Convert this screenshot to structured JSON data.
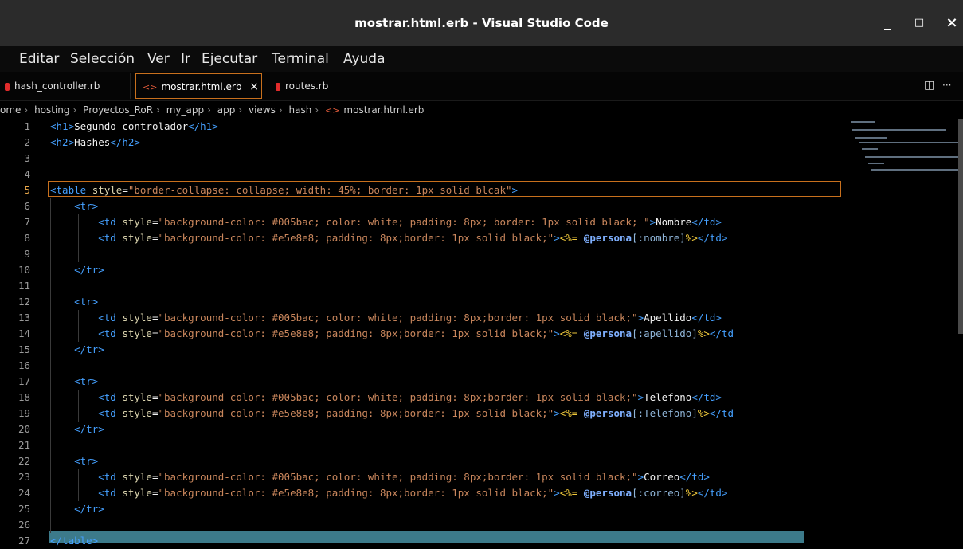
{
  "window": {
    "title": "mostrar.html.erb - Visual Studio Code",
    "minimize": "_",
    "maximize": "□",
    "close": "×"
  },
  "menu": [
    "Editar",
    "Selección",
    "Ver",
    "Ir",
    "Ejecutar",
    "Terminal",
    "Ayuda"
  ],
  "tabs": [
    {
      "label": "hash_controller.rb",
      "icon": "ruby-icon"
    },
    {
      "label": "mostrar.html.erb",
      "icon": "html-icon",
      "active": true,
      "close": "×"
    },
    {
      "label": "routes.rb",
      "icon": "ruby-icon"
    }
  ],
  "tab_actions": {
    "split": "◫",
    "more": "···"
  },
  "breadcrumb": [
    "home",
    "hosting",
    "Proyectos_RoR",
    "my_app",
    "app",
    "views",
    "hash",
    "mostrar.html.erb"
  ],
  "breadcrumb_first_visible": "ome",
  "editor": {
    "current_line": 5,
    "lines": [
      {
        "n": "1",
        "tokens": [
          [
            "tag",
            "<h1>"
          ],
          [
            "txt",
            "Segundo controlador"
          ],
          [
            "tag",
            "</h1>"
          ]
        ]
      },
      {
        "n": "2",
        "tokens": [
          [
            "tag",
            "<h2>"
          ],
          [
            "txt",
            "Hashes"
          ],
          [
            "tag",
            "</h2>"
          ]
        ]
      },
      {
        "n": "3",
        "tokens": []
      },
      {
        "n": "4",
        "tokens": []
      },
      {
        "n": "5",
        "tokens": [
          [
            "tag",
            "<table "
          ],
          [
            "attr",
            "style"
          ],
          [
            "txt",
            "="
          ],
          [
            "str",
            "\"border-collapse: collapse; width: 45%; border: 1px solid blcak\""
          ],
          [
            "tag",
            ">"
          ]
        ]
      },
      {
        "n": "6",
        "tokens": [
          [
            "txt",
            "    "
          ],
          [
            "tag",
            "<tr>"
          ]
        ]
      },
      {
        "n": "7",
        "tokens": [
          [
            "txt",
            "        "
          ],
          [
            "tag",
            "<td "
          ],
          [
            "attr",
            "style"
          ],
          [
            "txt",
            "="
          ],
          [
            "str",
            "\"background-color: #005bac; color: white; padding: 8px; border: 1px solid black; \""
          ],
          [
            "tag",
            ">"
          ],
          [
            "txt",
            "Nombre"
          ],
          [
            "tag",
            "</td>"
          ]
        ]
      },
      {
        "n": "8",
        "tokens": [
          [
            "txt",
            "        "
          ],
          [
            "tag",
            "<td "
          ],
          [
            "attr",
            "style"
          ],
          [
            "txt",
            "="
          ],
          [
            "str",
            "\"background-color: #e5e8e8; padding: 8px;border: 1px solid black;\""
          ],
          [
            "tag",
            ">"
          ],
          [
            "erb",
            "<%= "
          ],
          [
            "ivar",
            "@persona"
          ],
          [
            "sym",
            "[:nombre]"
          ],
          [
            "erb",
            "%>"
          ],
          [
            "tag",
            "</td>"
          ]
        ]
      },
      {
        "n": "9",
        "tokens": []
      },
      {
        "n": "10",
        "tokens": [
          [
            "txt",
            "    "
          ],
          [
            "tag",
            "</tr>"
          ]
        ]
      },
      {
        "n": "11",
        "tokens": []
      },
      {
        "n": "12",
        "tokens": [
          [
            "txt",
            "    "
          ],
          [
            "tag",
            "<tr>"
          ]
        ]
      },
      {
        "n": "13",
        "tokens": [
          [
            "txt",
            "        "
          ],
          [
            "tag",
            "<td "
          ],
          [
            "attr",
            "style"
          ],
          [
            "txt",
            "="
          ],
          [
            "str",
            "\"background-color: #005bac; color: white; padding: 8px;border: 1px solid black;\""
          ],
          [
            "tag",
            ">"
          ],
          [
            "txt",
            "Apellido"
          ],
          [
            "tag",
            "</td>"
          ]
        ]
      },
      {
        "n": "14",
        "tokens": [
          [
            "txt",
            "        "
          ],
          [
            "tag",
            "<td "
          ],
          [
            "attr",
            "style"
          ],
          [
            "txt",
            "="
          ],
          [
            "str",
            "\"background-color: #e5e8e8; padding: 8px;border: 1px solid black;\""
          ],
          [
            "tag",
            ">"
          ],
          [
            "erb",
            "<%= "
          ],
          [
            "ivar",
            "@persona"
          ],
          [
            "sym",
            "[:apellido]"
          ],
          [
            "erb",
            "%>"
          ],
          [
            "tag",
            "</td"
          ]
        ]
      },
      {
        "n": "15",
        "tokens": [
          [
            "txt",
            "    "
          ],
          [
            "tag",
            "</tr>"
          ]
        ]
      },
      {
        "n": "16",
        "tokens": []
      },
      {
        "n": "17",
        "tokens": [
          [
            "txt",
            "    "
          ],
          [
            "tag",
            "<tr>"
          ]
        ]
      },
      {
        "n": "18",
        "tokens": [
          [
            "txt",
            "        "
          ],
          [
            "tag",
            "<td "
          ],
          [
            "attr",
            "style"
          ],
          [
            "txt",
            "="
          ],
          [
            "str",
            "\"background-color: #005bac; color: white; padding: 8px;border: 1px solid black;\""
          ],
          [
            "tag",
            ">"
          ],
          [
            "txt",
            "Telefono"
          ],
          [
            "tag",
            "</td>"
          ]
        ]
      },
      {
        "n": "19",
        "tokens": [
          [
            "txt",
            "        "
          ],
          [
            "tag",
            "<td "
          ],
          [
            "attr",
            "style"
          ],
          [
            "txt",
            "="
          ],
          [
            "str",
            "\"background-color: #e5e8e8; padding: 8px;border: 1px solid black;\""
          ],
          [
            "tag",
            ">"
          ],
          [
            "erb",
            "<%= "
          ],
          [
            "ivar",
            "@persona"
          ],
          [
            "sym",
            "[:Telefono]"
          ],
          [
            "erb",
            "%>"
          ],
          [
            "tag",
            "</td"
          ]
        ]
      },
      {
        "n": "20",
        "tokens": [
          [
            "txt",
            "    "
          ],
          [
            "tag",
            "</tr>"
          ]
        ]
      },
      {
        "n": "21",
        "tokens": []
      },
      {
        "n": "22",
        "tokens": [
          [
            "txt",
            "    "
          ],
          [
            "tag",
            "<tr>"
          ]
        ]
      },
      {
        "n": "23",
        "tokens": [
          [
            "txt",
            "        "
          ],
          [
            "tag",
            "<td "
          ],
          [
            "attr",
            "style"
          ],
          [
            "txt",
            "="
          ],
          [
            "str",
            "\"background-color: #005bac; color: white; padding: 8px;border: 1px solid black;\""
          ],
          [
            "tag",
            ">"
          ],
          [
            "txt",
            "Correo"
          ],
          [
            "tag",
            "</td>"
          ]
        ]
      },
      {
        "n": "24",
        "tokens": [
          [
            "txt",
            "        "
          ],
          [
            "tag",
            "<td "
          ],
          [
            "attr",
            "style"
          ],
          [
            "txt",
            "="
          ],
          [
            "str",
            "\"background-color: #e5e8e8; padding: 8px;border: 1px solid black;\""
          ],
          [
            "tag",
            ">"
          ],
          [
            "erb",
            "<%= "
          ],
          [
            "ivar",
            "@persona"
          ],
          [
            "sym",
            "[:correo]"
          ],
          [
            "erb",
            "%>"
          ],
          [
            "tag",
            "</td>"
          ]
        ]
      },
      {
        "n": "25",
        "tokens": [
          [
            "txt",
            "    "
          ],
          [
            "tag",
            "</tr>"
          ]
        ]
      },
      {
        "n": "26",
        "tokens": []
      },
      {
        "n": "27",
        "tokens": [
          [
            "tag",
            "</table>"
          ]
        ]
      }
    ]
  }
}
